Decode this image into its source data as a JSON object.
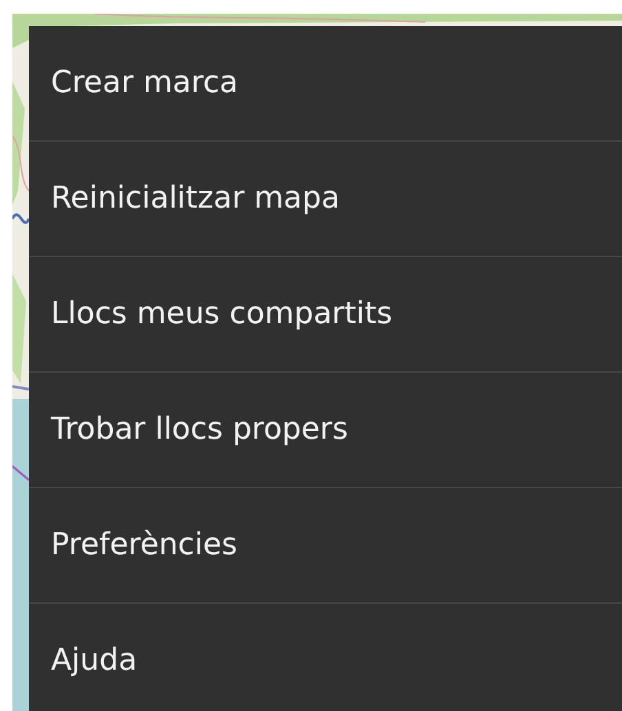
{
  "menu": {
    "items": [
      {
        "label": "Crear marca"
      },
      {
        "label": "Reinicialitzar mapa"
      },
      {
        "label": "Llocs meus compartits"
      },
      {
        "label": "Trobar llocs propers"
      },
      {
        "label": "Preferències"
      },
      {
        "label": "Ajuda"
      }
    ]
  }
}
